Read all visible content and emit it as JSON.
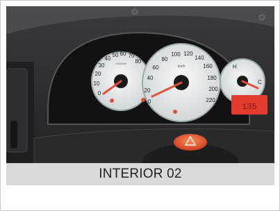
{
  "photo": {
    "subject": "car-dashboard-instrument-cluster",
    "colors": {
      "dashboard": "#2b2b2e",
      "gauge_face": "#eef0f1",
      "needle": "#e0503a",
      "display": "#e53b2e",
      "hazard_button": "#e8562f"
    },
    "tachometer": {
      "ticks": [
        "0",
        "10",
        "20",
        "30",
        "40",
        "50",
        "60",
        "70",
        "80"
      ],
      "unit": "x100/min"
    },
    "speedometer": {
      "ticks": [
        "0",
        "20",
        "40",
        "60",
        "80",
        "100",
        "120",
        "140",
        "160",
        "180",
        "200",
        "220"
      ],
      "unit": "km/h"
    },
    "temperature_gauge": {
      "high": "H",
      "low": "C"
    },
    "odometer_display": "135"
  },
  "caption": {
    "text": "INTERIOR 02"
  }
}
